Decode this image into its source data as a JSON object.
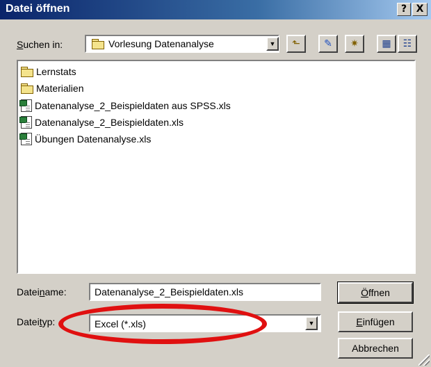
{
  "window": {
    "title": "Datei öffnen"
  },
  "titlebar_buttons": {
    "help": "?",
    "close": "X"
  },
  "lookin": {
    "label_prefix": "",
    "label_accel": "S",
    "label_rest": "uchen in:",
    "value": "Vorlesung Datenanalyse"
  },
  "toolbar": {
    "icons": [
      "folder-up-icon",
      "favorites-icon",
      "new-folder-icon",
      "list-view-icon",
      "details-view-icon"
    ]
  },
  "files": [
    {
      "name": "Lernstats",
      "type": "folder"
    },
    {
      "name": "Materialien",
      "type": "folder"
    },
    {
      "name": "Datenanalyse_2_Beispieldaten aus SPSS.xls",
      "type": "xls"
    },
    {
      "name": "Datenanalyse_2_Beispieldaten.xls",
      "type": "xls"
    },
    {
      "name": "Übungen Datenanalyse.xls",
      "type": "xls"
    }
  ],
  "filename": {
    "label_prefix": "Datei",
    "label_accel": "n",
    "label_rest": "ame:",
    "value": "Datenanalyse_2_Beispieldaten.xls"
  },
  "filetype": {
    "label_prefix": "Datei",
    "label_accel": "t",
    "label_rest": "yp:",
    "value": "Excel (*.xls)"
  },
  "buttons": {
    "open_accel": "Ö",
    "open_rest": "ffnen",
    "insert_accel": "E",
    "insert_rest": "infügen",
    "cancel": "Abbrechen"
  },
  "colors": {
    "highlight_ellipse": "#e01010",
    "titlebar": "#0a246a"
  }
}
